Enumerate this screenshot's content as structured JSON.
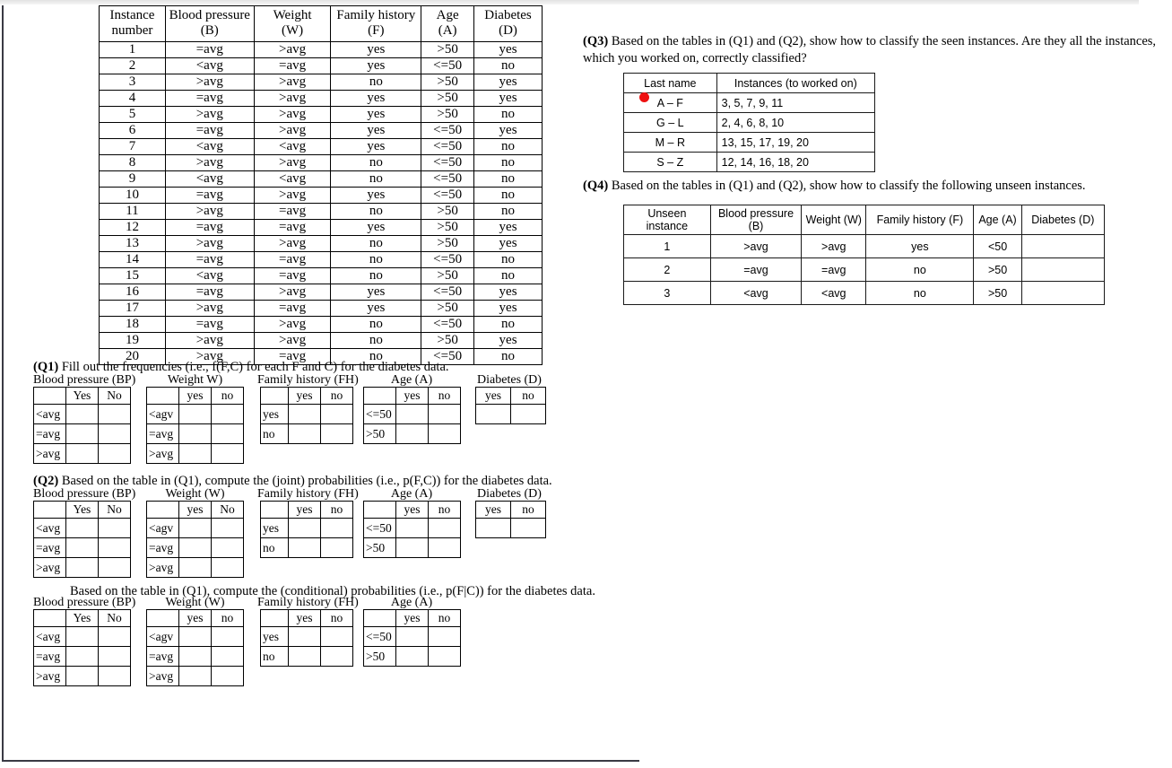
{
  "main_table": {
    "headers": [
      "Instance number",
      "Blood pressure (B)",
      "Weight (W)",
      "Family history (F)",
      "Age (A)",
      "Diabetes (D)"
    ],
    "header_lines": [
      [
        "Instance",
        "number"
      ],
      [
        "Blood pressure",
        "(B)"
      ],
      [
        "Weight",
        "(W)"
      ],
      [
        "Family history",
        "(F)"
      ],
      [
        "Age",
        "(A)"
      ],
      [
        "Diabetes",
        "(D)"
      ]
    ],
    "rows": [
      [
        "1",
        "=avg",
        ">avg",
        "yes",
        ">50",
        "yes"
      ],
      [
        "2",
        "<avg",
        "=avg",
        "yes",
        "<=50",
        "no"
      ],
      [
        "3",
        ">avg",
        ">avg",
        "no",
        ">50",
        "yes"
      ],
      [
        "4",
        "=avg",
        ">avg",
        "yes",
        ">50",
        "yes"
      ],
      [
        "5",
        ">avg",
        ">avg",
        "yes",
        ">50",
        "no"
      ],
      [
        "6",
        "=avg",
        ">avg",
        "yes",
        "<=50",
        "yes"
      ],
      [
        "7",
        "<avg",
        "<avg",
        "yes",
        "<=50",
        "no"
      ],
      [
        "8",
        ">avg",
        ">avg",
        "no",
        "<=50",
        "no"
      ],
      [
        "9",
        "<avg",
        "<avg",
        "no",
        "<=50",
        "no"
      ],
      [
        "10",
        "=avg",
        ">avg",
        "yes",
        "<=50",
        "no"
      ],
      [
        "11",
        ">avg",
        "=avg",
        "no",
        ">50",
        "no"
      ],
      [
        "12",
        "=avg",
        "=avg",
        "yes",
        ">50",
        "yes"
      ],
      [
        "13",
        ">avg",
        ">avg",
        "no",
        ">50",
        "yes"
      ],
      [
        "14",
        "=avg",
        "=avg",
        "no",
        "<=50",
        "no"
      ],
      [
        "15",
        "<avg",
        "=avg",
        "no",
        ">50",
        "no"
      ],
      [
        "16",
        "=avg",
        ">avg",
        "yes",
        "<=50",
        "yes"
      ],
      [
        "17",
        ">avg",
        "=avg",
        "yes",
        ">50",
        "yes"
      ],
      [
        "18",
        "=avg",
        ">avg",
        "no",
        "<=50",
        "no"
      ],
      [
        "19",
        ">avg",
        ">avg",
        "no",
        ">50",
        "yes"
      ],
      [
        "20",
        ">avg",
        "=avg",
        "no",
        "<=50",
        "no"
      ]
    ]
  },
  "q1": {
    "prompt_label": "(Q1)",
    "prompt_text": " Fill out the frequencies (i.e., f(F,C) for each F and C) for the diabetes data.",
    "captions": {
      "bp": "Blood pressure (BP)",
      "weight": "Weight W)",
      "fh": "Family history (FH)",
      "age": "Age (A)",
      "diabetes": "Diabetes (D)"
    },
    "bp": {
      "col_headers": [
        "Yes",
        "No"
      ],
      "row_labels": [
        "<avg",
        "=avg",
        ">avg"
      ]
    },
    "weight": {
      "col_headers": [
        "yes",
        "no"
      ],
      "row_labels": [
        "<agv",
        "=avg",
        ">avg"
      ]
    },
    "fh": {
      "col_headers": [
        "yes",
        "no"
      ],
      "row_labels": [
        "yes",
        "no"
      ]
    },
    "age": {
      "col_headers": [
        "yes",
        "no"
      ],
      "row_labels": [
        "<=50",
        ">50"
      ]
    },
    "diabetes": {
      "col_headers": [
        "yes",
        "no"
      ],
      "row_labels": [
        ""
      ]
    }
  },
  "q2": {
    "prompt_label": "(Q2)",
    "prompt_text": " Based on the table in (Q1), compute the (joint) probabilities (i.e., p(F,C)) for the diabetes data.",
    "captions": {
      "bp": "Blood pressure (BP)",
      "weight": "Weight (W)",
      "fh": "Family history (FH)",
      "age": "Age (A)",
      "diabetes": "Diabetes (D)"
    },
    "bp": {
      "col_headers": [
        "Yes",
        "No"
      ],
      "row_labels": [
        "<avg",
        "=avg",
        ">avg"
      ]
    },
    "weight": {
      "col_headers": [
        "yes",
        "No"
      ],
      "row_labels": [
        "<agv",
        "=avg",
        ">avg"
      ]
    },
    "fh": {
      "col_headers": [
        "yes",
        "no"
      ],
      "row_labels": [
        "yes",
        "no"
      ]
    },
    "age": {
      "col_headers": [
        "yes",
        "no"
      ],
      "row_labels": [
        "<=50",
        ">50"
      ]
    },
    "diabetes": {
      "col_headers": [
        "yes",
        "no"
      ],
      "row_labels": [
        ""
      ]
    }
  },
  "q2b": {
    "prompt_text": "Based on the table in (Q1), compute the (conditional) probabilities (i.e., p(F|C)) for the diabetes data.",
    "captions": {
      "bp": "Blood pressure (BP)",
      "weight": "Weight (W)",
      "fh": "Family history (FH)",
      "age": "Age (A)"
    },
    "bp": {
      "col_headers": [
        "Yes",
        "No"
      ],
      "row_labels": [
        "<avg",
        "=avg",
        ">avg"
      ]
    },
    "weight": {
      "col_headers": [
        "yes",
        "no"
      ],
      "row_labels": [
        "<agv",
        "=avg",
        ">avg"
      ]
    },
    "fh": {
      "col_headers": [
        "yes",
        "no"
      ],
      "row_labels": [
        "yes",
        "no"
      ]
    },
    "age": {
      "col_headers": [
        "yes",
        "no"
      ],
      "row_labels": [
        "<=50",
        ">50"
      ]
    }
  },
  "q3": {
    "prompt_label": "(Q3)",
    "prompt_text": " Based on the tables in (Q1) and (Q2), show how to classify the seen instances. Are they all the instances, which you worked on, correctly classified?",
    "table": {
      "headers": [
        "Last name",
        "Instances (to worked on)"
      ],
      "rows": [
        [
          "A – F",
          "3, 5, 7, 9, 11"
        ],
        [
          "G – L",
          "2, 4, 6, 8, 10"
        ],
        [
          "M – R",
          "13, 15, 17, 19, 20"
        ],
        [
          "S – Z",
          "12, 14, 16, 18, 20"
        ]
      ]
    }
  },
  "q4": {
    "prompt_label": "(Q4)",
    "prompt_text": " Based on the tables in (Q1) and (Q2), show how to classify the following unseen instances.",
    "table": {
      "headers": [
        "Unseen instance",
        "Blood pressure (B)",
        "Weight (W)",
        "Family history (F)",
        "Age (A)",
        "Diabetes (D)"
      ],
      "rows": [
        [
          "1",
          ">avg",
          ">avg",
          "yes",
          "<50",
          ""
        ],
        [
          "2",
          "=avg",
          "=avg",
          "no",
          ">50",
          ""
        ],
        [
          "3",
          "<avg",
          "<avg",
          "no",
          ">50",
          ""
        ]
      ]
    }
  },
  "cursor": {
    "color": "#ee1111"
  }
}
